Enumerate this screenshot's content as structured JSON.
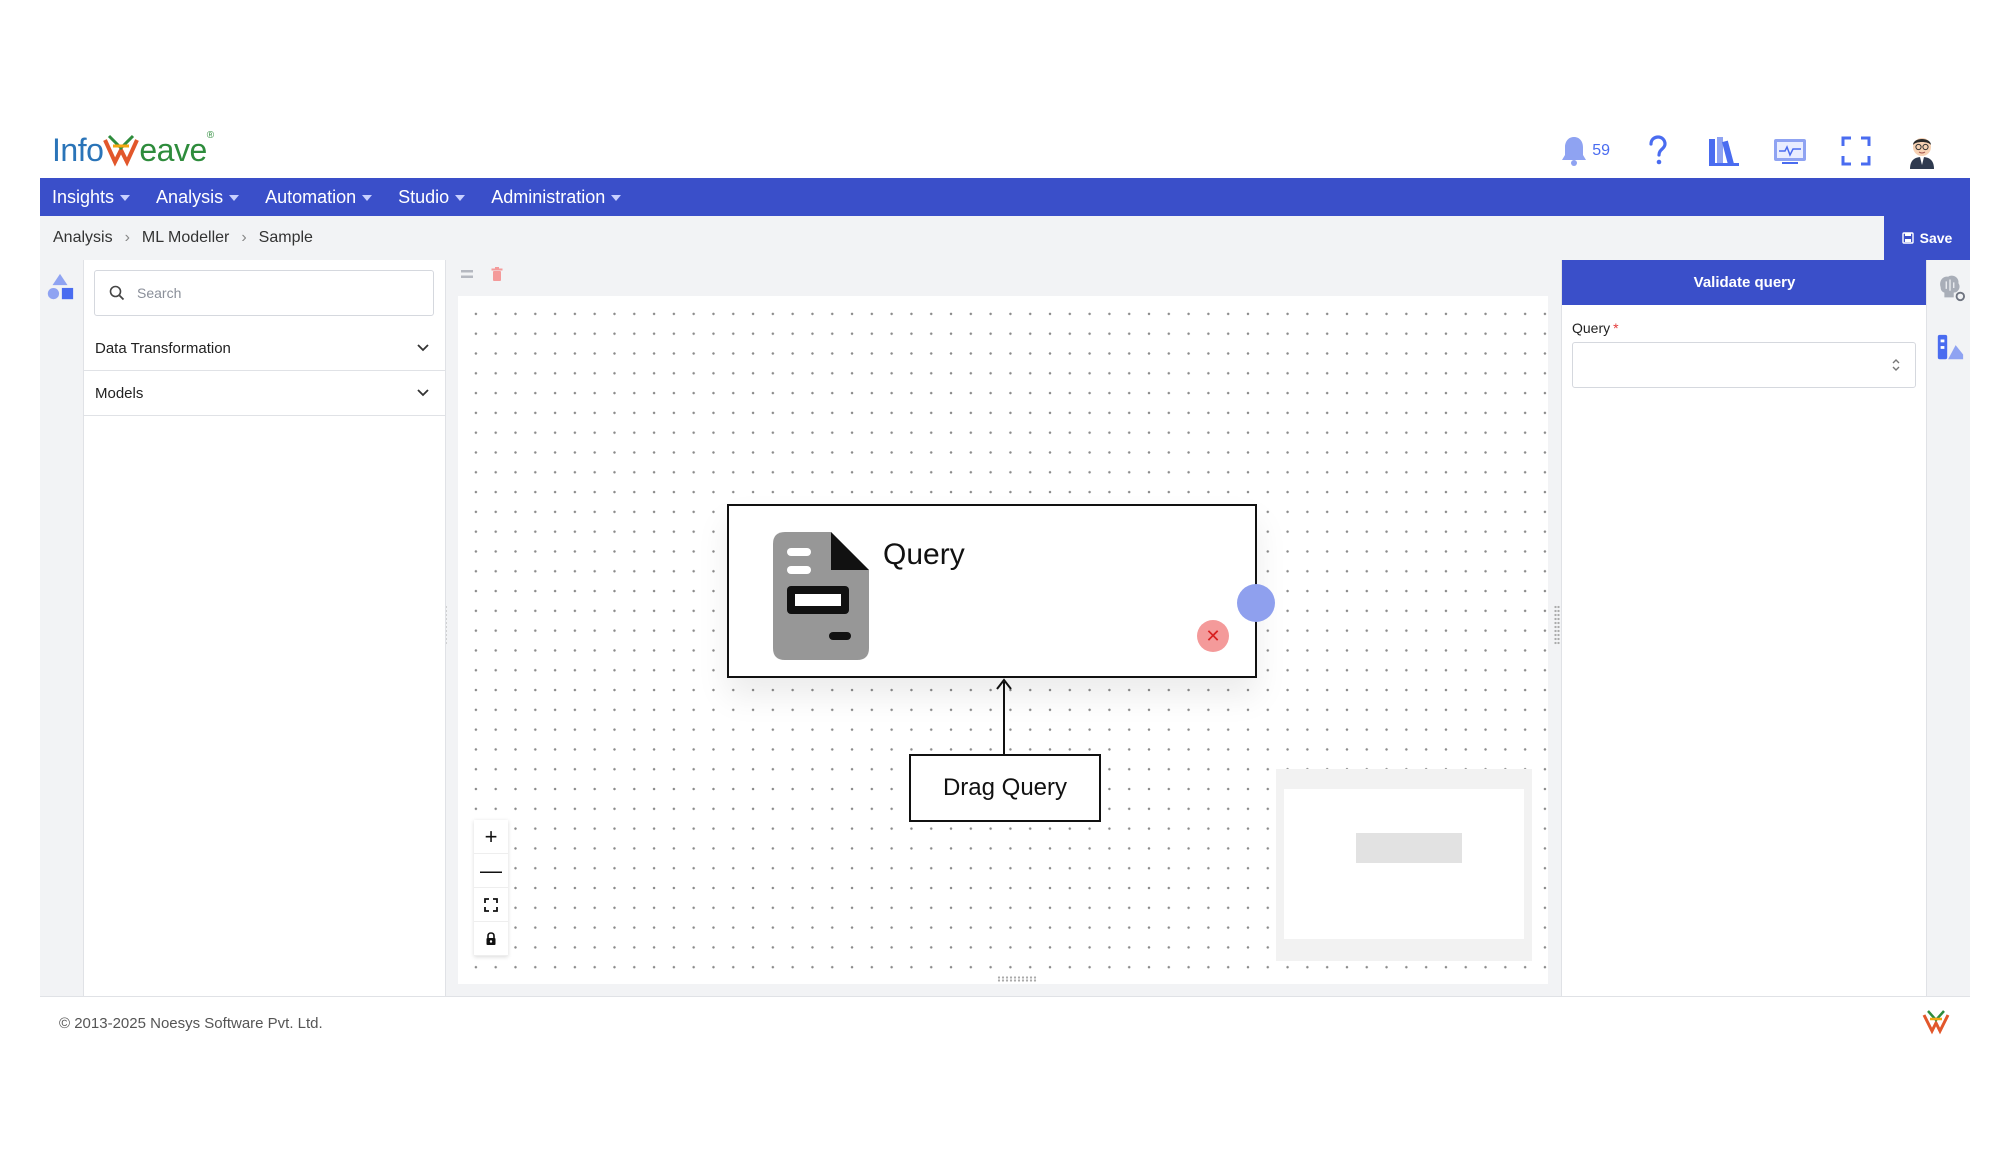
{
  "brand": {
    "name_part1": "Info",
    "name_part2": "eave",
    "reg": "®"
  },
  "header": {
    "notification_count": "59",
    "icons": [
      "bell-icon",
      "help-icon",
      "library-icon",
      "monitor-icon",
      "fullscreen-icon",
      "user-avatar"
    ]
  },
  "nav": {
    "items": [
      {
        "label": "Insights"
      },
      {
        "label": "Analysis"
      },
      {
        "label": "Automation"
      },
      {
        "label": "Studio"
      },
      {
        "label": "Administration"
      }
    ]
  },
  "breadcrumb": {
    "items": [
      "Analysis",
      "ML Modeller",
      "Sample"
    ]
  },
  "toolbar": {
    "save_label": "Save"
  },
  "left_panel": {
    "search_placeholder": "Search",
    "sections": [
      {
        "label": "Data Transformation"
      },
      {
        "label": "Models"
      }
    ]
  },
  "canvas": {
    "node": {
      "title": "Query"
    },
    "drag_node": {
      "label": "Drag Query"
    },
    "zoom_controls": [
      "+",
      "—"
    ]
  },
  "right_panel": {
    "validate_label": "Validate query",
    "query_label": "Query",
    "required_marker": "*"
  },
  "footer": {
    "copyright": "© 2013-2025 Noesys Software Pvt. Ltd."
  },
  "colors": {
    "primary": "#3a4fc9",
    "port": "#8fa0ee",
    "close": "#f49a9a",
    "brand_blue": "#2a74b8",
    "brand_green": "#2e8c3c"
  }
}
